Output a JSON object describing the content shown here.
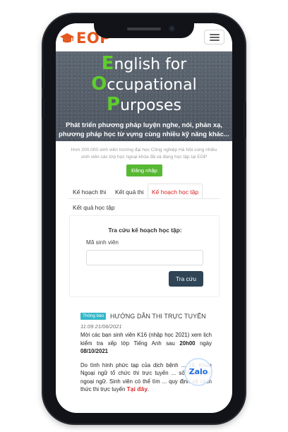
{
  "header": {
    "logo_text": "EOP",
    "menu_icon": "hamburger-menu-icon",
    "brand_color": "#e4571d"
  },
  "hero": {
    "lines": [
      {
        "initial": "E",
        "rest": "nglish for"
      },
      {
        "initial": "O",
        "rest": "ccupational"
      },
      {
        "initial": "P",
        "rest": "urposes"
      }
    ],
    "subtitle_line1": "Phát triển phương pháp luyện nghe, nói, phản xạ,",
    "subtitle_line2": "phương pháp học từ vựng cùng nhiều kỹ năng khác...",
    "accent_color": "#5fce2b"
  },
  "intro": {
    "line1": "Hơn 200.000 sinh viên trường đại học Công nghiệp Hà Nội sùng nhiều",
    "line2": "sinh viên các lớp học ngoại khóa đã và đang học tập tại EOP",
    "register_label": "Đăng nhập"
  },
  "tabs": [
    {
      "label": "Kế hoạch thi",
      "active": false
    },
    {
      "label": "Kết quả thi",
      "active": false
    },
    {
      "label": "Kế hoạch học tập",
      "active": true
    },
    {
      "label": "Kết quả học tập",
      "active": false
    }
  ],
  "lookup": {
    "title": "Tra cứu kế hoạch học tập:",
    "field_label": "Mã sinh viên",
    "field_value": "",
    "button_label": "Tra cứu"
  },
  "news": {
    "badge": "Thông báo",
    "title": "HƯỚNG DẪN THI TRỰC TUYẾN",
    "date": "11:09 21/06/2021",
    "p1_a": "Mời các bạn sinh viên K16 (nhập học 2021) xem lịch kiểm tra xếp lớp Tiếng Anh sau ",
    "p1_b": "20h00",
    "p1_c": " ngày ",
    "p1_d": "08/10/2021",
    "p2": "Do tình hình phức tạp của dịch bệnh ... 19, Khoa Ngoại ngữ tổ chức thi trực tuyến ... số học phần ngoại ngữ. Sinh viên có thể tìm ... quy định và cách thức thi trực tuyến ",
    "p2_link": "Tại đây",
    "p2_end": "."
  },
  "zalo": {
    "label": "Zalo",
    "color": "#1f6de0"
  }
}
